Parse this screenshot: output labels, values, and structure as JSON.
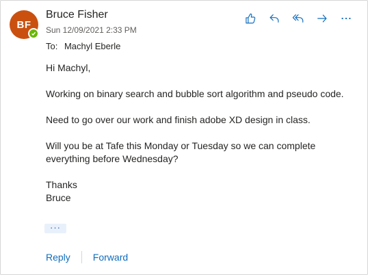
{
  "message": {
    "sender_initials": "BF",
    "sender_name": "Bruce Fisher",
    "date": "Sun 12/09/2021 2:33 PM",
    "to_label": "To:",
    "recipient": "Machyl Eberle",
    "body": {
      "greeting": "Hi Machyl,",
      "para1": "Working on binary search and bubble sort algorithm and pseudo code.",
      "para2": "Need to go over our work and finish adobe XD design in class.",
      "para3": "Will you be at Tafe this Monday or Tuesday so we can complete everything before Wednesday?",
      "closing": "Thanks",
      "signature": "Bruce"
    },
    "more_label": "···"
  },
  "toolbar": {
    "icons": [
      "like-icon",
      "reply-icon",
      "reply-all-icon",
      "forward-icon",
      "more-actions-icon"
    ]
  },
  "footer": {
    "reply_label": "Reply",
    "forward_label": "Forward"
  },
  "colors": {
    "accent": "#0f6cbd",
    "avatar": "#ca5010",
    "presence": "#6bb700"
  }
}
